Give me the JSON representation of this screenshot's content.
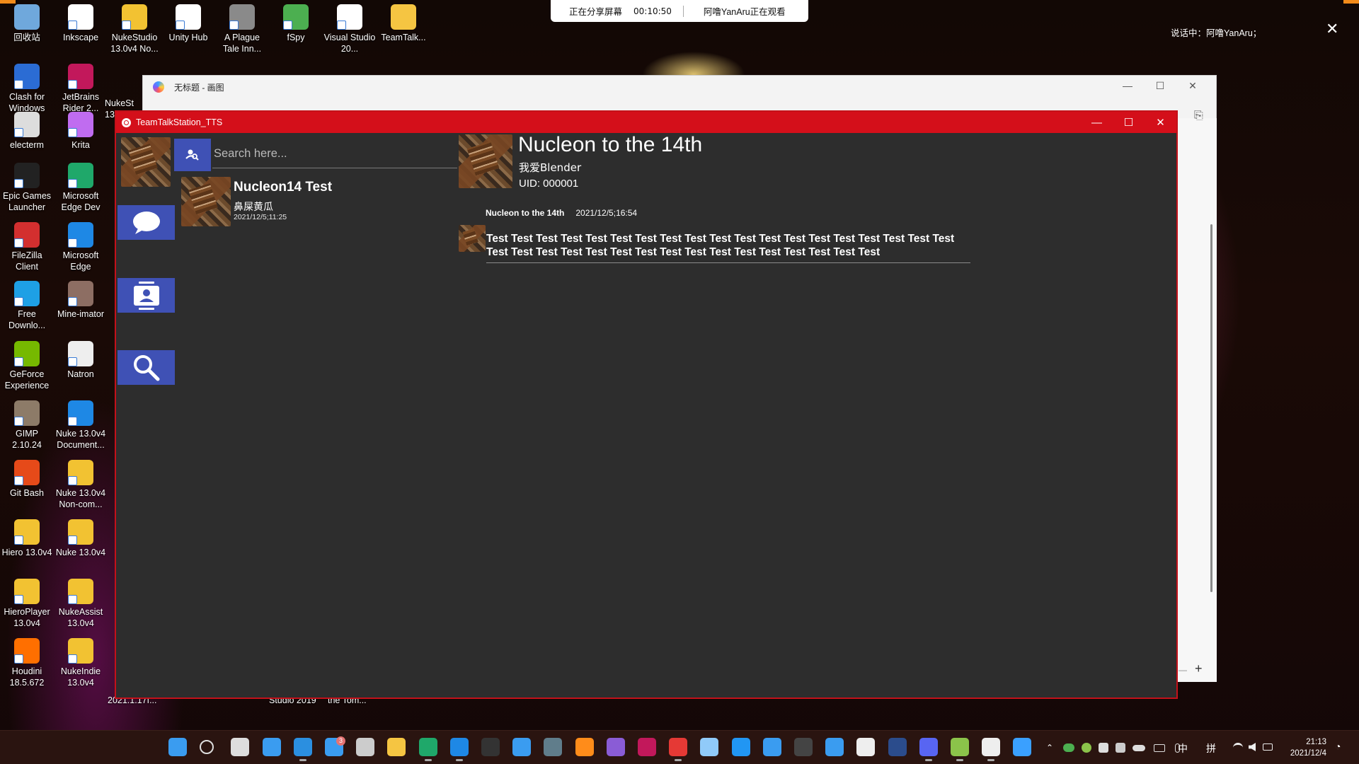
{
  "desktop": {
    "icons": [
      {
        "label": "回收站",
        "color": "#6fa8dc"
      },
      {
        "label": "Inkscape",
        "color": "#ffffff"
      },
      {
        "label": "NukeStudio 13.0v4 No...",
        "color": "#f2c232"
      },
      {
        "label": "Unity Hub",
        "color": "#ffffff"
      },
      {
        "label": "A Plague Tale Inn...",
        "color": "#8a8a8a"
      },
      {
        "label": "fSpy",
        "color": "#4caf50"
      },
      {
        "label": "Visual Studio 20...",
        "color": "#ffffff"
      },
      {
        "label": "TeamTalk...",
        "color": "#f5c542"
      },
      {
        "label": "Clash for Windows",
        "color": "#2b6cd4"
      },
      {
        "label": "JetBrains Rider 2...",
        "color": "#c2185b"
      },
      {
        "label": "electerm",
        "color": "#dddddd"
      },
      {
        "label": "Krita",
        "color": "#c06cf0"
      },
      {
        "label": "Epic Games Launcher",
        "color": "#222222"
      },
      {
        "label": "Microsoft Edge Dev",
        "color": "#1fa86a"
      },
      {
        "label": "FileZilla Client",
        "color": "#d32f2f"
      },
      {
        "label": "Microsoft Edge",
        "color": "#1e88e5"
      },
      {
        "label": "Free Downlo...",
        "color": "#1ea0e5"
      },
      {
        "label": "Mine-imator",
        "color": "#8d6e63"
      },
      {
        "label": "GeForce Experience",
        "color": "#76b900"
      },
      {
        "label": "Natron",
        "color": "#eeeeee"
      },
      {
        "label": "GIMP 2.10.24",
        "color": "#8d7b68"
      },
      {
        "label": "Nuke 13.0v4 Document...",
        "color": "#1e88e5"
      },
      {
        "label": "Git Bash",
        "color": "#e64a19"
      },
      {
        "label": "Nuke 13.0v4 Non-com...",
        "color": "#f2c232"
      },
      {
        "label": "Hiero 13.0v4",
        "color": "#f2c232"
      },
      {
        "label": "Nuke 13.0v4",
        "color": "#f2c232"
      },
      {
        "label": "HieroPlayer 13.0v4",
        "color": "#f2c232"
      },
      {
        "label": "NukeAssist 13.0v4",
        "color": "#f2c232"
      },
      {
        "label": "Houdini 18.5.672",
        "color": "#ff6f00"
      },
      {
        "label": "NukeIndie 13.0v4",
        "color": "#f2c232"
      }
    ],
    "partial_labels": [
      "NukeSt 13.0",
      "2021.1.17f...",
      "Studio 2019",
      "the Tom..."
    ]
  },
  "share_banner": {
    "sharing_text": "正在分享屏幕",
    "timer": "00:10:50",
    "watcher_text": "阿噜YanAru正在观看"
  },
  "overlay": {
    "speaking_text": "说话中：阿噜YanAru；",
    "close_glyph": "✕"
  },
  "paint_window": {
    "title": "无标题 - 画图",
    "minimize": "—",
    "maximize": "☐",
    "close": "✕",
    "zoom_plus": "+",
    "zoom_minus": "—"
  },
  "tts_window": {
    "title": "TeamTalkStation_TTS",
    "minimize": "—",
    "maximize": "☐",
    "close": "✕",
    "accent": "#d40f1a",
    "nav_color": "#3f51b5",
    "search": {
      "placeholder": "Search here..."
    },
    "conversations": [
      {
        "name": "Nucleon14 Test",
        "preview": "鼻屎黄瓜",
        "time": "2021/12/5;11:25"
      }
    ],
    "chat": {
      "title": "Nucleon to the 14th",
      "subtitle": "我爱Blender",
      "uid": "UID: 000001",
      "messages": [
        {
          "sender": "Nucleon to the 14th",
          "time": "2021/12/5;16:54",
          "text": "Test Test Test Test Test Test Test Test Test Test Test Test Test Test Test Test Test Test Test Test Test Test Test Test Test Test Test Test Test Test Test Test Test Test Test"
        }
      ]
    }
  },
  "taskbar": {
    "apps": [
      {
        "name": "start",
        "color": "#3a9cf0"
      },
      {
        "name": "search",
        "color": "#dddddd"
      },
      {
        "name": "task-view",
        "color": "#dddddd"
      },
      {
        "name": "widgets",
        "color": "#3a9cf0"
      },
      {
        "name": "vscode",
        "color": "#2b8fe0"
      },
      {
        "name": "mail",
        "color": "#3a9cf0"
      },
      {
        "name": "obs",
        "color": "#cccccc"
      },
      {
        "name": "file-explorer",
        "color": "#f5c542"
      },
      {
        "name": "edge-dev",
        "color": "#1fa86a"
      },
      {
        "name": "edge",
        "color": "#1e88e5"
      },
      {
        "name": "epic-games",
        "color": "#333333"
      },
      {
        "name": "store",
        "color": "#3a9cf0"
      },
      {
        "name": "gitkraken",
        "color": "#607d8b"
      },
      {
        "name": "blender",
        "color": "#ff8c1a"
      },
      {
        "name": "visual-studio",
        "color": "#8a5cd6"
      },
      {
        "name": "rider",
        "color": "#c2185b"
      },
      {
        "name": "netease",
        "color": "#e53935"
      },
      {
        "name": "app-orb",
        "color": "#90caf9"
      },
      {
        "name": "kdenlive",
        "color": "#2196f3"
      },
      {
        "name": "settings",
        "color": "#3a9cf0"
      },
      {
        "name": "terminal",
        "color": "#444444"
      },
      {
        "name": "feishu",
        "color": "#3a9cf0"
      },
      {
        "name": "notes",
        "color": "#eeeeee"
      },
      {
        "name": "clash",
        "color": "#2b4c8c"
      },
      {
        "name": "discord",
        "color": "#5865f2"
      },
      {
        "name": "game-app",
        "color": "#8bc34a"
      },
      {
        "name": "teamtalk",
        "color": "#eeeeee"
      },
      {
        "name": "paint",
        "color": "#3aa0ff"
      }
    ],
    "mail_badge": "3",
    "ime_primary": "中",
    "ime_secondary": "拼",
    "clock_time": "21:13",
    "clock_date": "2021/12/4"
  }
}
